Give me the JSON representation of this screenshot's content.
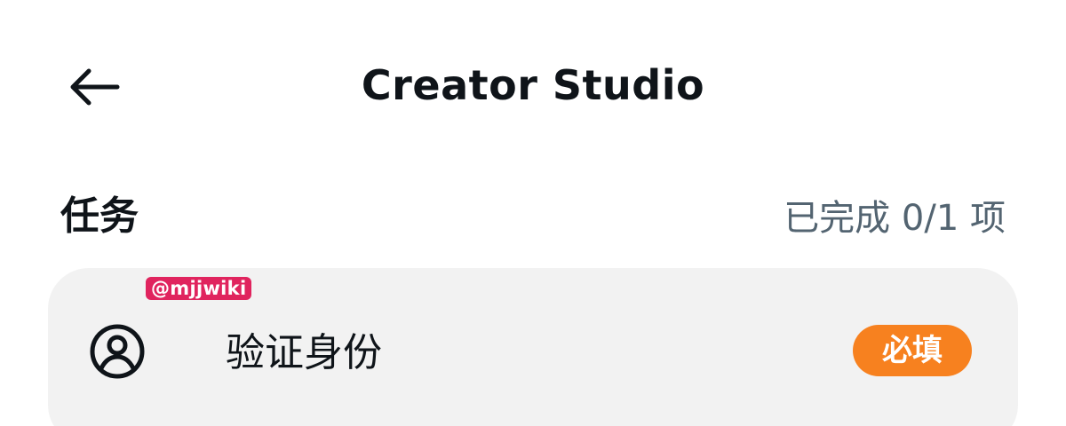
{
  "header": {
    "title": "Creator Studio",
    "back_icon": "arrow-left-icon"
  },
  "tasks_section": {
    "title": "任务",
    "progress": "已完成 0/1 项",
    "completed": 0,
    "total": 1
  },
  "watermark": "@mjjwiki",
  "tasks": [
    {
      "icon": "user-circle-icon",
      "label": "验证身份",
      "badge": "必填"
    }
  ],
  "colors": {
    "badge_bg": "#f7811f",
    "card_bg": "#f2f2f2",
    "text_primary": "#0f1419",
    "text_secondary": "#536471",
    "watermark_bg": "#e0245e"
  }
}
